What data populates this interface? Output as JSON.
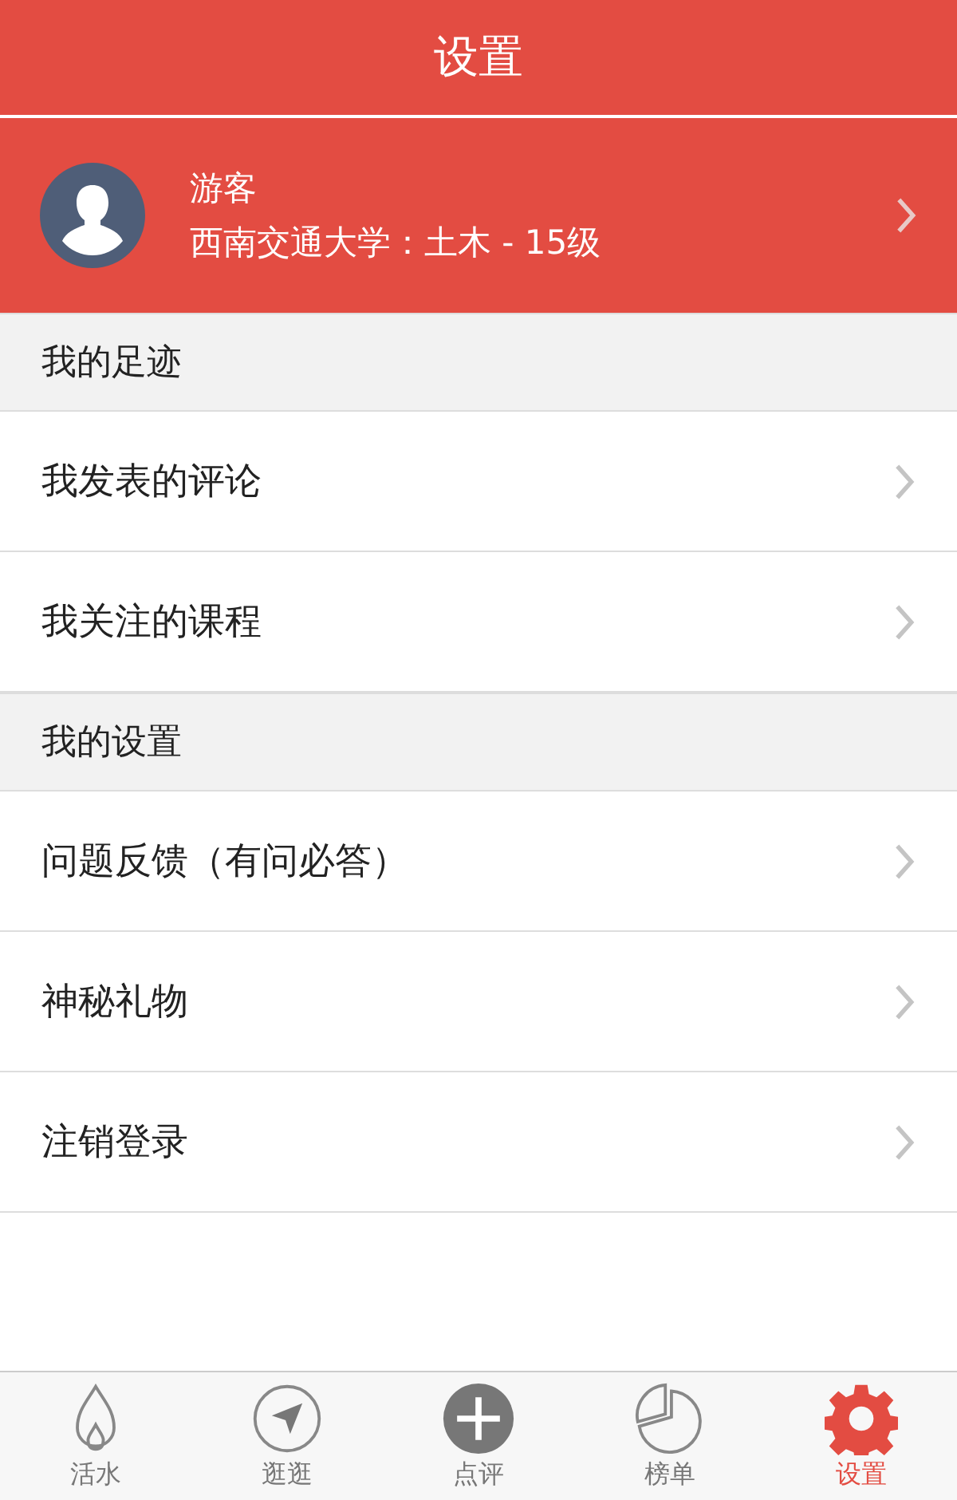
{
  "header": {
    "title": "设置"
  },
  "profile": {
    "name": "游客",
    "detail": "西南交通大学：土木 - 15级"
  },
  "sections": [
    {
      "title": "我的足迹",
      "items": [
        {
          "label": "我发表的评论"
        },
        {
          "label": "我关注的课程"
        }
      ]
    },
    {
      "title": "我的设置",
      "items": [
        {
          "label": "问题反馈（有问必答）"
        },
        {
          "label": "神秘礼物"
        },
        {
          "label": "注销登录"
        }
      ]
    }
  ],
  "tabs": [
    {
      "label": "活水",
      "selected": false
    },
    {
      "label": "逛逛",
      "selected": false
    },
    {
      "label": "点评",
      "selected": false
    },
    {
      "label": "榜单",
      "selected": false
    },
    {
      "label": "设置",
      "selected": true
    }
  ]
}
